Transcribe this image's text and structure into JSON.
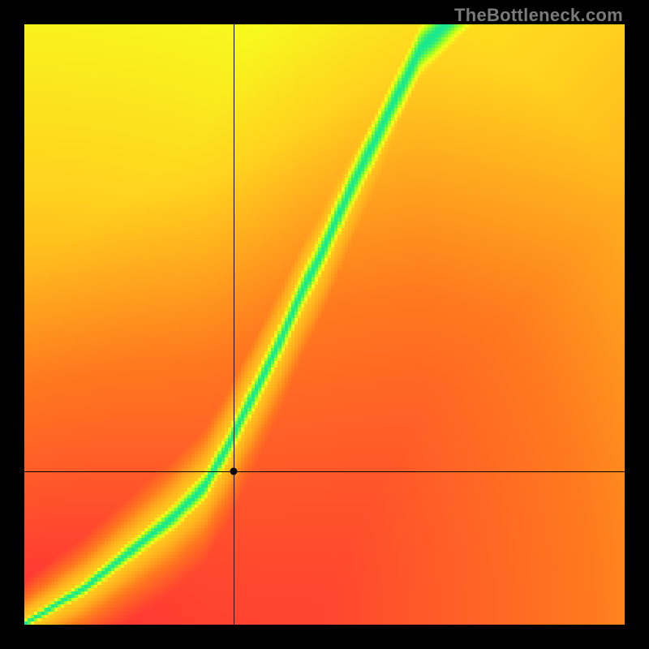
{
  "watermark": "TheBottleneck.com",
  "chart_data": {
    "type": "heatmap",
    "title": "",
    "xlabel": "",
    "ylabel": "",
    "xlim": [
      0,
      1
    ],
    "ylim": [
      0,
      1
    ],
    "grid": false,
    "legend": false,
    "crosshair": {
      "x": 0.348,
      "y": 0.255
    },
    "marker": {
      "x": 0.348,
      "y": 0.255
    },
    "series": [
      {
        "name": "optimal-band",
        "description": "Green optimal-match ridge from bottom-left to upper-middle",
        "points": [
          {
            "x": 0.0,
            "y": 0.0
          },
          {
            "x": 0.05,
            "y": 0.03
          },
          {
            "x": 0.1,
            "y": 0.06
          },
          {
            "x": 0.15,
            "y": 0.1
          },
          {
            "x": 0.2,
            "y": 0.14
          },
          {
            "x": 0.25,
            "y": 0.18
          },
          {
            "x": 0.3,
            "y": 0.23
          },
          {
            "x": 0.34,
            "y": 0.3
          },
          {
            "x": 0.38,
            "y": 0.38
          },
          {
            "x": 0.42,
            "y": 0.46
          },
          {
            "x": 0.46,
            "y": 0.55
          },
          {
            "x": 0.5,
            "y": 0.63
          },
          {
            "x": 0.54,
            "y": 0.72
          },
          {
            "x": 0.58,
            "y": 0.8
          },
          {
            "x": 0.62,
            "y": 0.88
          },
          {
            "x": 0.66,
            "y": 0.96
          },
          {
            "x": 0.7,
            "y": 1.0
          }
        ]
      }
    ],
    "colormap": {
      "stops": [
        {
          "t": 0.0,
          "color": "#ff1e3c"
        },
        {
          "t": 0.35,
          "color": "#ff7a1e"
        },
        {
          "t": 0.55,
          "color": "#ffd21e"
        },
        {
          "t": 0.72,
          "color": "#f6ff1e"
        },
        {
          "t": 0.85,
          "color": "#9eff1e"
        },
        {
          "t": 1.0,
          "color": "#17e88f"
        }
      ]
    },
    "resolution": 180
  }
}
